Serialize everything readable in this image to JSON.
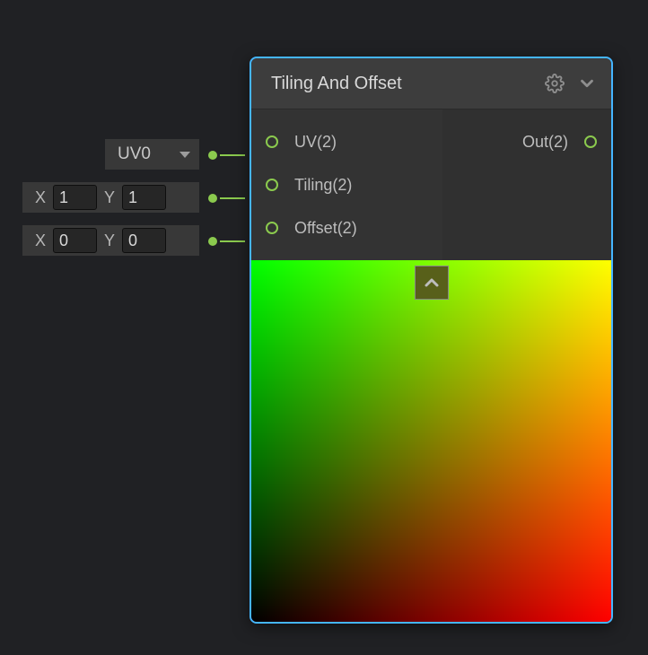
{
  "node": {
    "title": "Tiling And Offset",
    "inputs": [
      {
        "label": "UV(2)"
      },
      {
        "label": "Tiling(2)"
      },
      {
        "label": "Offset(2)"
      }
    ],
    "outputs": [
      {
        "label": "Out(2)"
      }
    ]
  },
  "externals": {
    "uv_dropdown": {
      "selected": "UV0"
    },
    "tiling": {
      "x_label": "X",
      "x_value": "1",
      "y_label": "Y",
      "y_value": "1"
    },
    "offset": {
      "x_label": "X",
      "x_value": "0",
      "y_label": "Y",
      "y_value": "0"
    }
  },
  "colors": {
    "port": "#8bca4e",
    "selection": "#45b5ff"
  }
}
